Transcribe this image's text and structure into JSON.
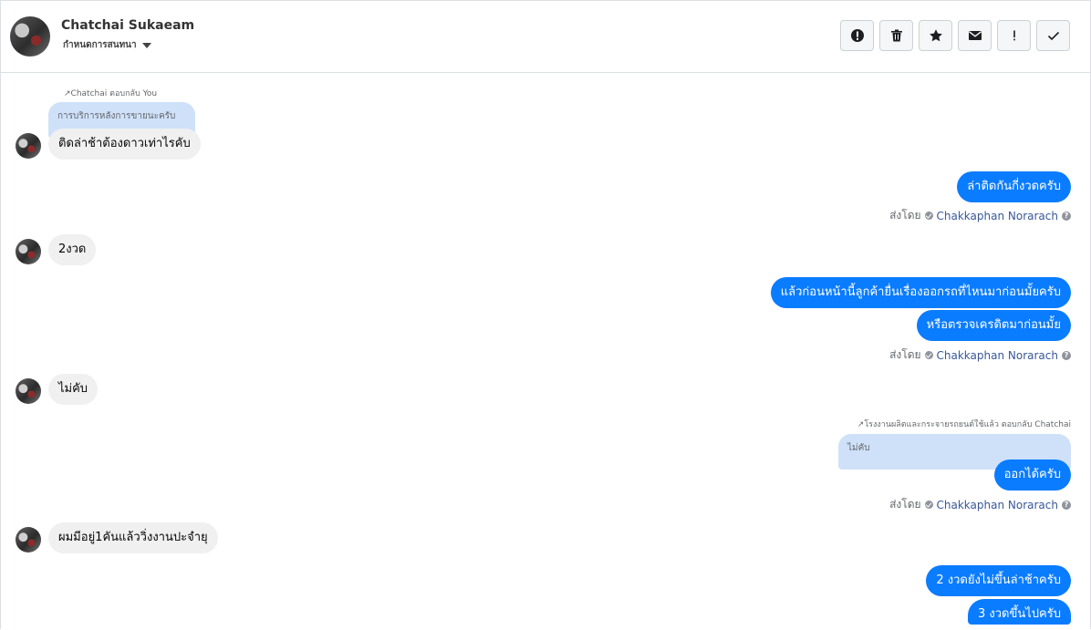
{
  "header": {
    "contact_name": "Chatchai Sukaeam",
    "status": "กำหนดการสนทนา",
    "toolbar": [
      "alert-circle-icon",
      "trash-icon",
      "star-icon",
      "mail-icon",
      "exclamation-icon",
      "check-icon"
    ]
  },
  "messages": {
    "m1_reply_note": "Chatchai ตอบกลับ You",
    "m1_quoted": "การบริการหลังการขายนะครับ",
    "m1_text": "ติดล่าช้าต้องดาวเท่าไรคับ",
    "m2_text": "ล่าติดกันกี่งวดครับ",
    "m3_text": "2งวด",
    "m4_text": "แล้วก่อนหน้านี้ลูกค้ายื่นเรื่องออกรถที่ไหนมาก่อนมั้ยครับ",
    "m5_text": "หรือตรวจเครดิตมาก่อนมั้ย",
    "m6_text": "ไม่คับ",
    "m7_reply_note": "โรงงานผลิตและกระจายรถยนต์ใช้แล้ว ตอบกลับ Chatchai",
    "m7_quoted": "ไม่คับ",
    "m7_text": "ออกได้ครับ",
    "m8_text": "ผมมีอยู่1คันแล้ววิ่งงานปะจำยุ",
    "m9_text": "2 งวดยังไม่ขึ้นล่าช้าครับ",
    "m10_text": "3 งวดขึ้นไปครับ"
  },
  "sent_by": {
    "label": "ส่งโดย",
    "agent": "Chakkaphan Norarach"
  },
  "colors": {
    "outgoing": "#0a7cff",
    "incoming": "#f0f0f0",
    "quoted": "#cfe1f9",
    "agent_link": "#385898"
  }
}
